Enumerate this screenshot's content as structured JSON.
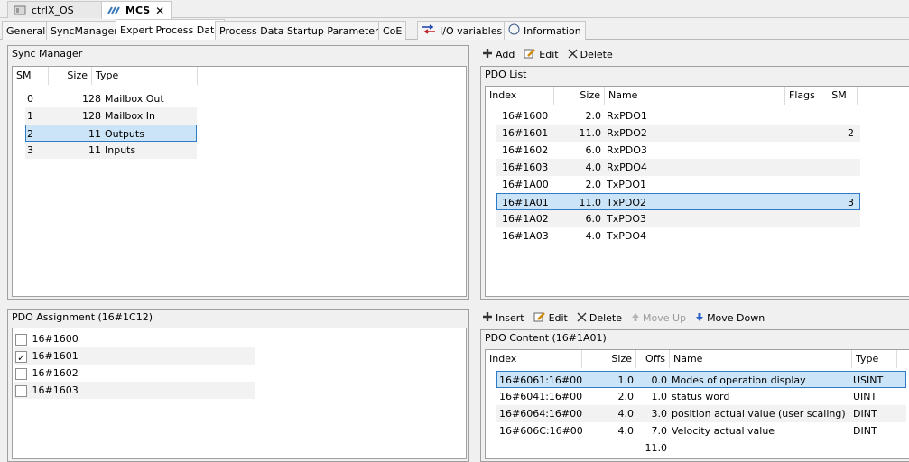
{
  "doc_tabs": [
    {
      "label": "ctrlX_OS",
      "active": false
    },
    {
      "label": "MCS",
      "active": true
    }
  ],
  "editor_tabs": [
    {
      "label": "General"
    },
    {
      "label": "SyncManager"
    },
    {
      "label": "Expert Process Data"
    },
    {
      "label": "Process Data"
    },
    {
      "label": "Startup Parameters"
    },
    {
      "label": "CoE"
    },
    {
      "label": "I/O variables"
    },
    {
      "label": "Information"
    }
  ],
  "sync_manager": {
    "title": "Sync Manager",
    "headers": {
      "sm": "SM",
      "size": "Size",
      "type": "Type"
    },
    "rows": [
      {
        "sm": "0",
        "size": "128",
        "type": "Mailbox Out"
      },
      {
        "sm": "1",
        "size": "128",
        "type": "Mailbox In"
      },
      {
        "sm": "2",
        "size": "11",
        "type": "Outputs"
      },
      {
        "sm": "3",
        "size": "11",
        "type": "Inputs"
      }
    ]
  },
  "pdo_toolbar": {
    "add": "Add",
    "edit": "Edit",
    "delete": "Delete"
  },
  "pdo_list": {
    "title": "PDO List",
    "headers": {
      "index": "Index",
      "size": "Size",
      "name": "Name",
      "flags": "Flags",
      "sm": "SM"
    },
    "rows": [
      {
        "index": "16#1600",
        "size": "2.0",
        "name": "RxPDO1",
        "flags": "",
        "sm": ""
      },
      {
        "index": "16#1601",
        "size": "11.0",
        "name": "RxPDO2",
        "flags": "",
        "sm": "2"
      },
      {
        "index": "16#1602",
        "size": "6.0",
        "name": "RxPDO3",
        "flags": "",
        "sm": ""
      },
      {
        "index": "16#1603",
        "size": "4.0",
        "name": "RxPDO4",
        "flags": "",
        "sm": ""
      },
      {
        "index": "16#1A00",
        "size": "2.0",
        "name": "TxPDO1",
        "flags": "",
        "sm": ""
      },
      {
        "index": "16#1A01",
        "size": "11.0",
        "name": "TxPDO2",
        "flags": "",
        "sm": "3"
      },
      {
        "index": "16#1A02",
        "size": "6.0",
        "name": "TxPDO3",
        "flags": "",
        "sm": ""
      },
      {
        "index": "16#1A03",
        "size": "4.0",
        "name": "TxPDO4",
        "flags": "",
        "sm": ""
      }
    ]
  },
  "pdo_assignment": {
    "title": "PDO Assignment (16#1C12)",
    "items": [
      {
        "label": "16#1600",
        "checked": false
      },
      {
        "label": "16#1601",
        "checked": true
      },
      {
        "label": "16#1602",
        "checked": false
      },
      {
        "label": "16#1603",
        "checked": false
      }
    ]
  },
  "content_toolbar": {
    "insert": "Insert",
    "edit": "Edit",
    "delete": "Delete",
    "move_up": "Move Up",
    "move_down": "Move Down"
  },
  "pdo_content": {
    "title": "PDO Content (16#1A01)",
    "headers": {
      "index": "Index",
      "size": "Size",
      "offs": "Offs",
      "name": "Name",
      "type": "Type"
    },
    "rows": [
      {
        "index": "16#6061:16#00",
        "size": "1.0",
        "offs": "0.0",
        "name": "Modes of operation display",
        "type": "USINT"
      },
      {
        "index": "16#6041:16#00",
        "size": "2.0",
        "offs": "1.0",
        "name": "status word",
        "type": "UINT"
      },
      {
        "index": "16#6064:16#00",
        "size": "4.0",
        "offs": "3.0",
        "name": "position actual value (user scaling)",
        "type": "DINT"
      },
      {
        "index": "16#606C:16#00",
        "size": "4.0",
        "offs": "7.0",
        "name": "Velocity actual value",
        "type": "DINT"
      }
    ],
    "total_offs": "11.0"
  },
  "colors": {
    "selection": "#cce4f7",
    "selection_border": "#2f7ac5"
  }
}
